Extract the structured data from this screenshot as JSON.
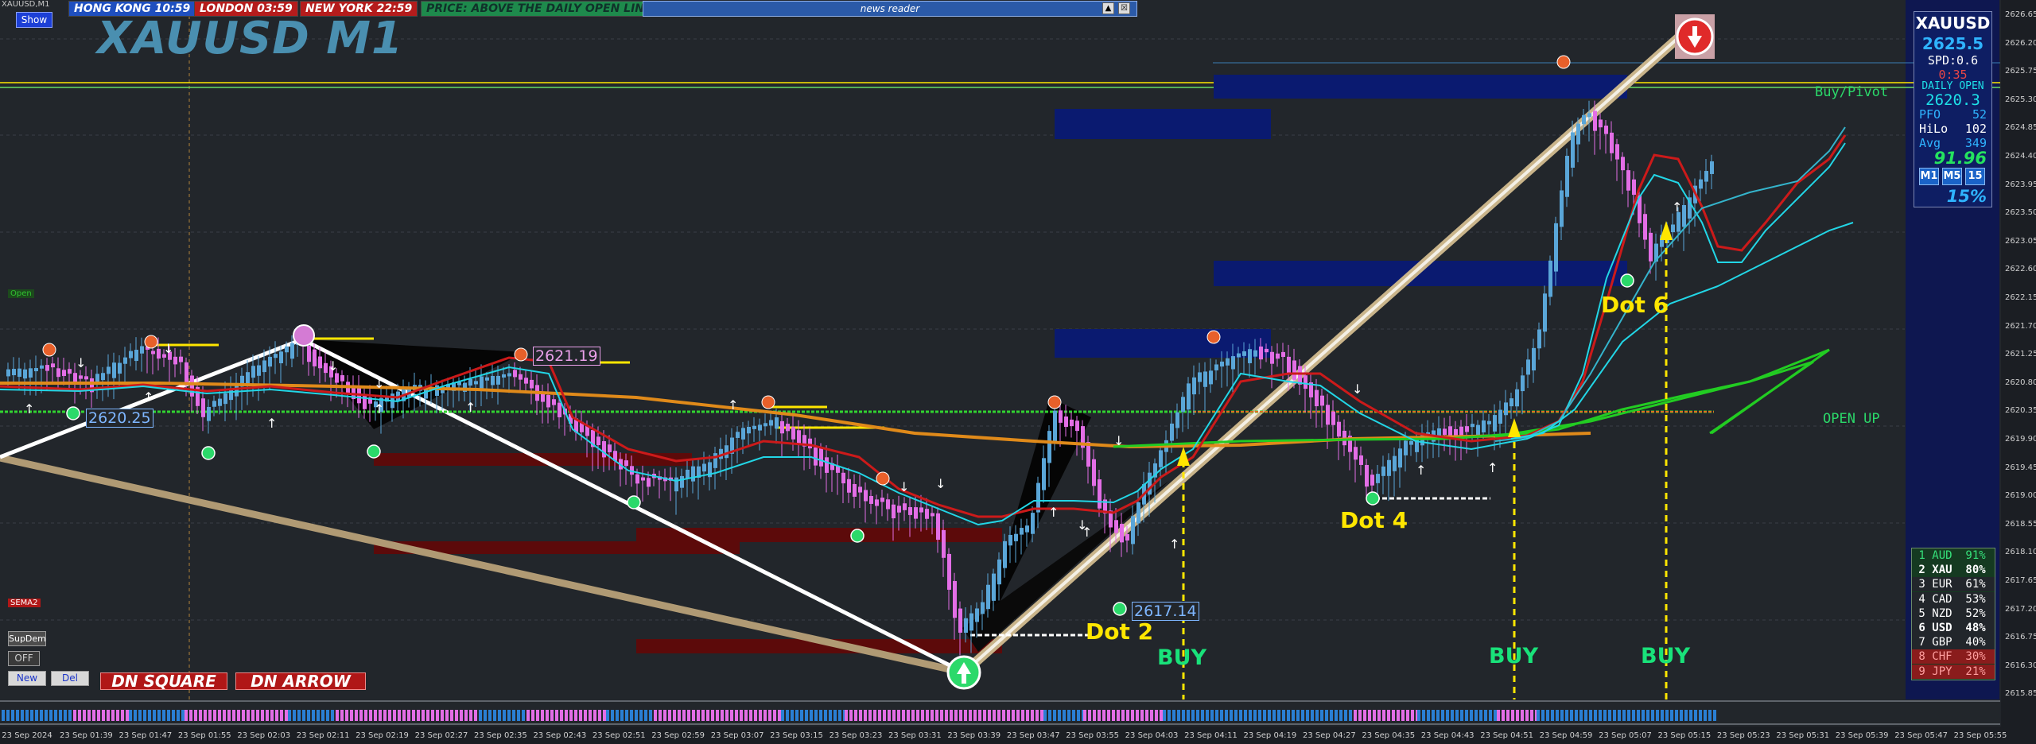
{
  "window": {
    "title": "XAUUSD,M1",
    "show_button": "Show"
  },
  "sessions": [
    {
      "label": "HONG KONG 10:59",
      "bg": "#1f4fbf",
      "fg": "#ffffff"
    },
    {
      "label": "LONDON 03:59",
      "bg": "#b51c1c",
      "fg": "#ffffff"
    },
    {
      "label": "NEW YORK 22:59",
      "bg": "#b51c1c",
      "fg": "#ffffff"
    },
    {
      "label": "PRICE: ABOVE THE DAILY OPEN LINE",
      "bg": "#1e8a4c",
      "fg": "#10322a"
    }
  ],
  "news_reader": {
    "label": "news reader",
    "controls": [
      "▲",
      "☒"
    ]
  },
  "symbol_title": "XAUUSD M1",
  "info_panel": {
    "symbol": "XAUUSD",
    "price": "2625.5",
    "spread": "SPD:0.6",
    "timer": "0:35",
    "daily_open_label": "DAILY OPEN",
    "daily_open_value": "2620.3",
    "pfo_label": "PFO",
    "pfo_value": "52",
    "hilo_label": "HiLo",
    "hilo_value": "102",
    "avg_label": "Avg",
    "avg_value": "349",
    "big_value": "91.96",
    "timeframes": [
      "M1",
      "M5",
      "15"
    ],
    "percent": "15%"
  },
  "currency_strength": [
    {
      "rank": "1",
      "code": "AUD",
      "pct": "91%",
      "bg": "#153a21",
      "fg": "#35e07a"
    },
    {
      "rank": "2",
      "code": "XAU",
      "pct": "80%",
      "bg": "#153a21",
      "fg": "#ffffff"
    },
    {
      "rank": "3",
      "code": "EUR",
      "pct": "61%",
      "bg": "#22262b",
      "fg": "#ffffff"
    },
    {
      "rank": "4",
      "code": "CAD",
      "pct": "53%",
      "bg": "#22262b",
      "fg": "#ffffff"
    },
    {
      "rank": "5",
      "code": "NZD",
      "pct": "52%",
      "bg": "#22262b",
      "fg": "#ffffff"
    },
    {
      "rank": "6",
      "code": "USD",
      "pct": "48%",
      "bg": "#22262b",
      "fg": "#ffffff"
    },
    {
      "rank": "7",
      "code": "GBP",
      "pct": "40%",
      "bg": "#22262b",
      "fg": "#ffffff"
    },
    {
      "rank": "8",
      "code": "CHF",
      "pct": "30%",
      "bg": "#8a1c1c",
      "fg": "#ff9f9f"
    },
    {
      "rank": "9",
      "code": "JPY",
      "pct": "21%",
      "bg": "#8a1c1c",
      "fg": "#ff9f9f"
    }
  ],
  "labels": {
    "buy_pivot": "Buy/Pivot",
    "open_up": "OPEN UP",
    "dot2": "Dot 2",
    "dot4": "Dot 4",
    "dot6": "Dot 6",
    "buy": "BUY",
    "price_2621": "2621.19",
    "price_2617": "2617.14",
    "price_2620": "2620.25",
    "sema2": "SEMA2",
    "open_tag": "Open",
    "supdem": "SupDem",
    "off": "OFF",
    "new": "New",
    "del": "Del",
    "dn_square": "DN SQUARE",
    "dn_arrow": "DN ARROW"
  },
  "y_axis_ticks": [
    "2626.65",
    "2626.20",
    "2625.75",
    "2625.30",
    "2624.85",
    "2624.40",
    "2623.95",
    "2623.50",
    "2623.05",
    "2622.60",
    "2622.15",
    "2621.70",
    "2621.25",
    "2620.80",
    "2620.35",
    "2619.90",
    "2619.45",
    "2619.00",
    "2618.55",
    "2618.10",
    "2617.65",
    "2617.20",
    "2616.75",
    "2616.30",
    "2615.85"
  ],
  "x_axis_ticks": [
    "23 Sep 2024",
    "23 Sep 01:39",
    "23 Sep 01:47",
    "23 Sep 01:55",
    "23 Sep 02:03",
    "23 Sep 02:11",
    "23 Sep 02:19",
    "23 Sep 02:27",
    "23 Sep 02:35",
    "23 Sep 02:43",
    "23 Sep 02:51",
    "23 Sep 02:59",
    "23 Sep 03:07",
    "23 Sep 03:15",
    "23 Sep 03:23",
    "23 Sep 03:31",
    "23 Sep 03:39",
    "23 Sep 03:47",
    "23 Sep 03:55",
    "23 Sep 04:03",
    "23 Sep 04:11",
    "23 Sep 04:19",
    "23 Sep 04:27",
    "23 Sep 04:35",
    "23 Sep 04:43",
    "23 Sep 04:51",
    "23 Sep 04:59",
    "23 Sep 05:07",
    "23 Sep 05:15",
    "23 Sep 05:23",
    "23 Sep 05:31",
    "23 Sep 05:39",
    "23 Sep 05:47",
    "23 Sep 05:55"
  ],
  "colors": {
    "background": "#22262b",
    "bull_candle": "#5aa6d8",
    "bear_candle": "#e36ee6",
    "ma_red": "#cc1a1a",
    "ma_cyan": "#22d6e6",
    "ma_orange": "#e08a1a",
    "ma_green": "#22cc22",
    "trend_line": "#b09a74",
    "zone_blue": "#0a1a70",
    "zone_red": "#5c0a0a"
  }
}
